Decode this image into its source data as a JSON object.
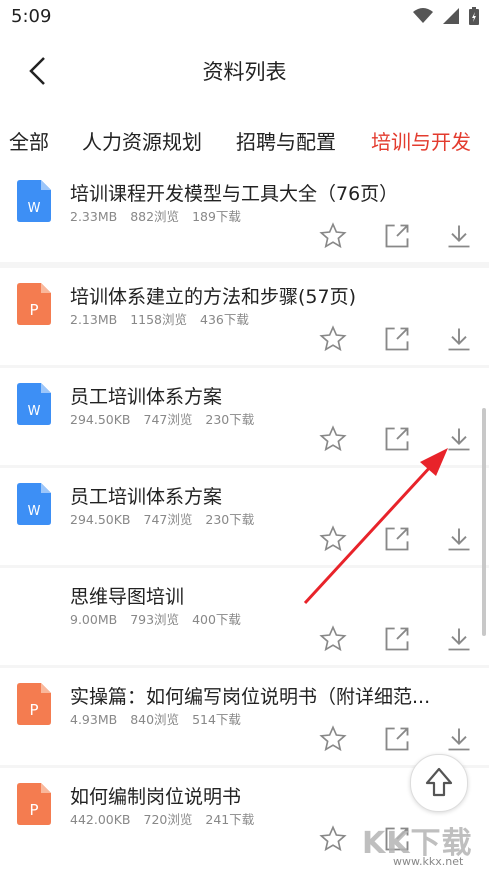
{
  "status_bar": {
    "time": "5:09"
  },
  "header": {
    "title": "资料列表"
  },
  "tabs": [
    {
      "label": "全部",
      "active": false
    },
    {
      "label": "人力资源规划",
      "active": false
    },
    {
      "label": "招聘与配置",
      "active": false
    },
    {
      "label": "培训与开发",
      "active": true
    }
  ],
  "items": [
    {
      "type": "word",
      "title": "培训课程开发模型与工具大全（76页）",
      "size": "2.33MB",
      "views": "882浏览",
      "downloads": "189下载"
    },
    {
      "type": "ppt",
      "title": "培训体系建立的方法和步骤(57页)",
      "size": "2.13MB",
      "views": "1158浏览",
      "downloads": "436下载"
    },
    {
      "type": "word",
      "title": "员工培训体系方案",
      "size": "294.50KB",
      "views": "747浏览",
      "downloads": "230下载"
    },
    {
      "type": "word",
      "title": "员工培训体系方案",
      "size": "294.50KB",
      "views": "747浏览",
      "downloads": "230下载"
    },
    {
      "type": "none",
      "title": "思维导图培训",
      "size": "9.00MB",
      "views": "793浏览",
      "downloads": "400下载"
    },
    {
      "type": "ppt",
      "title": "实操篇：如何编写岗位说明书（附详细范...",
      "size": "4.93MB",
      "views": "840浏览",
      "downloads": "514下载"
    },
    {
      "type": "ppt",
      "title": "如何编制岗位说明书",
      "size": "442.00KB",
      "views": "720浏览",
      "downloads": "241下载"
    }
  ],
  "icon_letters": {
    "word": "W",
    "ppt": "P"
  },
  "colors": {
    "accent": "#e33b2e",
    "word_icon": "#3d8ff5",
    "ppt_icon": "#f47c50"
  },
  "watermark": {
    "main": "KK下载",
    "url": "www.kkx.net"
  }
}
